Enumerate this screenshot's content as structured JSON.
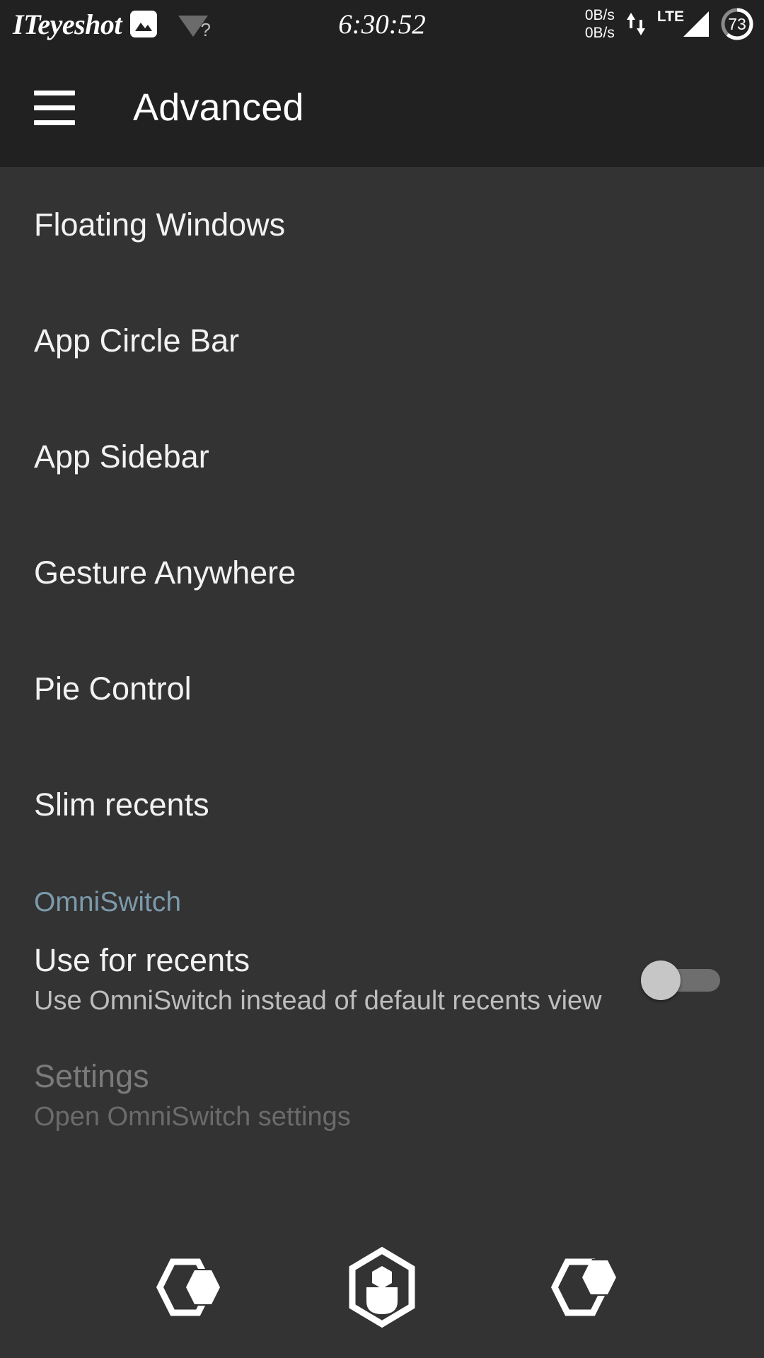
{
  "status_bar": {
    "watermark_text": "ITeyeshot",
    "image_icon": "image-icon",
    "wifi_icon": "wifi-unknown-icon",
    "wifi_badge": "?",
    "clock": "6:30:52",
    "net_up": "0B/s",
    "net_down": "0B/s",
    "data_arrows_icon": "data-transfer-arrows-icon",
    "network_type": "LTE",
    "signal_icon": "signal-bars-icon",
    "battery_level": "73",
    "battery_icon": "battery-circle-icon"
  },
  "app_bar": {
    "menu_icon": "hamburger-menu-icon",
    "title": "Advanced"
  },
  "preferences": [
    {
      "title": "Floating Windows"
    },
    {
      "title": "App Circle Bar"
    },
    {
      "title": "App Sidebar"
    },
    {
      "title": "Gesture Anywhere"
    },
    {
      "title": "Pie Control"
    },
    {
      "title": "Slim recents"
    }
  ],
  "omniswitch": {
    "category_title": "OmniSwitch",
    "category_color": "#7c9aab",
    "use_for_recents": {
      "title": "Use for recents",
      "summary": "Use OmniSwitch instead of default recents view",
      "toggle_state": "off"
    },
    "settings": {
      "title": "Settings",
      "summary": "Open OmniSwitch settings",
      "enabled": "false"
    }
  },
  "nav_bar": {
    "back_icon": "hexagon-back-icon",
    "home_icon": "hexagon-home-icon",
    "recents_icon": "hexagon-recents-icon"
  },
  "colors": {
    "header_bg": "#212121",
    "body_bg": "#333333",
    "accent": "#7c9aab",
    "primary_text": "#f2f2f2",
    "secondary_text": "#bdbdbd",
    "disabled_text": "#7a7a7a"
  }
}
